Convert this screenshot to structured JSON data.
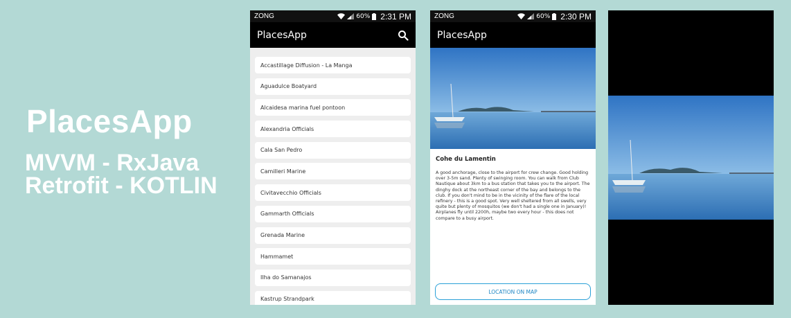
{
  "promo": {
    "title": "PlacesApp",
    "line1": "MVVM - RxJava",
    "line2": "Retrofit - KOTLIN"
  },
  "list_screen": {
    "status": {
      "carrier": "ZONG",
      "battery": "60%",
      "time": "2:31 PM"
    },
    "app_title": "PlacesApp",
    "search_icon": "search-icon",
    "places": [
      "Accastillage Diffusion - La Manga",
      "Aguadulce Boatyard",
      "Alcaidesa marina fuel pontoon",
      "Alexandria Officials",
      "Cala San Pedro",
      "Camilleri Marine",
      "Civitavecchio Officials",
      "Gammarth Officials",
      "Grenada Marine",
      "Hammamet",
      "Ilha do Samanajos",
      "Kastrup Strandpark"
    ]
  },
  "detail_screen": {
    "status": {
      "carrier": "ZONG",
      "battery": "60%",
      "time": "2:30 PM"
    },
    "app_title": "PlacesApp",
    "place_name": "Cohe du Lamentin",
    "description": "A good anchorage, close to the airport for crew change. Good holding over 3-5m sand. Plenty of swinging room. You can walk from Club Nautique about 3km to a bus station that takes you to the airport. The dinghy dock at the northeast corner of the bay and belongs to the club. If you don't mind to be in the vicinity of the flare of the local refinery - this is a good spot. Very well sheltered from all swells, very quite but plenty of mosquitos (we don't had a single one in January)! Airplanes fly until 2200h, maybe two every hour - this does not compare to a busy airport.",
    "map_button": "LOCATION ON MAP"
  },
  "colors": {
    "background": "#b3d9d5",
    "appbar": "#000000",
    "accent": "#29a0d8"
  }
}
